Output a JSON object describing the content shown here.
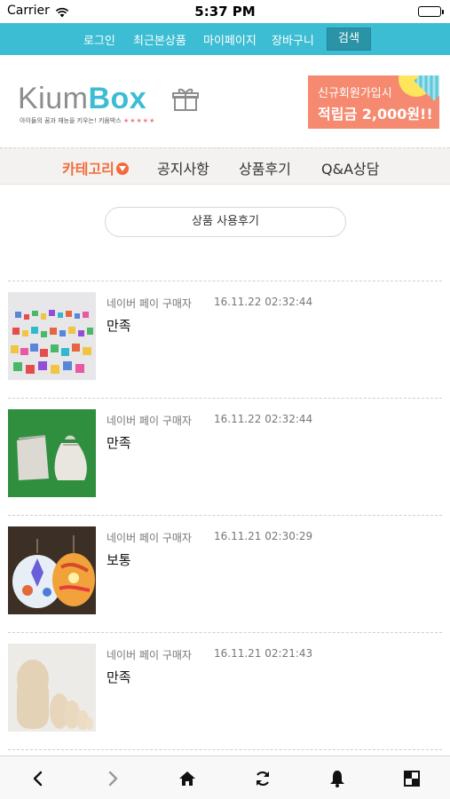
{
  "status_bar": {
    "carrier": "Carrier",
    "time": "5:37 PM"
  },
  "top_menu": {
    "items": [
      "로그인",
      "최근본상품",
      "마이페이지",
      "장바구니"
    ],
    "search_label": "검색",
    "color": "#3cbdd3"
  },
  "logo": {
    "wordmark_kium": "Kium",
    "wordmark_box": "Box",
    "tagline": "아이들의 꿈과 재능을 키우는! 키움박스",
    "stars": "★★★★★"
  },
  "banner": {
    "line1": "신규회원가입시",
    "line2": "적립금 2,000원!!"
  },
  "category_nav": {
    "items": [
      "카테고리",
      "공지사항",
      "상품후기",
      "Q&A상담"
    ],
    "active_color": "#f26d3d"
  },
  "section_pill": "상품 사용후기",
  "reviews": [
    {
      "author": "네이버 페이 구매자",
      "date": "16.11.22 02:32:44",
      "title": "만족",
      "image": "colorful-pieces"
    },
    {
      "author": "네이버 페이 구매자",
      "date": "16.11.22 02:32:44",
      "title": "만족",
      "image": "cloth-pouches"
    },
    {
      "author": "네이버 페이 구매자",
      "date": "16.11.21 02:30:29",
      "title": "보통",
      "image": "paper-lanterns"
    },
    {
      "author": "네이버 페이 구매자",
      "date": "16.11.21 02:21:43",
      "title": "만족",
      "image": "wooden-dolls"
    }
  ],
  "bottom_toolbar": [
    "back-icon",
    "forward-icon",
    "home-icon",
    "refresh-icon",
    "bell-icon",
    "grid-icon"
  ]
}
